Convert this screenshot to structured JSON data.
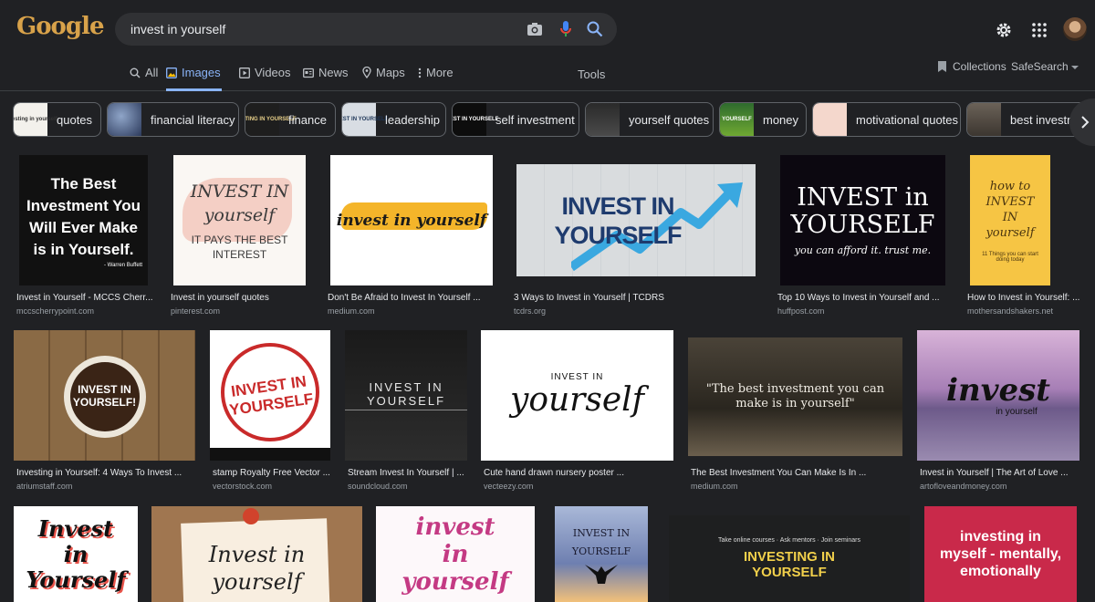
{
  "logo_text": "Google",
  "search": {
    "value": "invest in yourself"
  },
  "icons": {
    "camera": "camera-icon",
    "mic": "mic-icon",
    "search": "search-icon",
    "settings": "gear-icon",
    "apps": "apps-grid-icon"
  },
  "tabs": [
    {
      "label": "All"
    },
    {
      "label": "Images"
    },
    {
      "label": "Videos"
    },
    {
      "label": "News"
    },
    {
      "label": "Maps"
    },
    {
      "label": "More"
    }
  ],
  "tools_label": "Tools",
  "collections_label": "Collections",
  "safesearch_label": "SafeSearch",
  "chips": [
    {
      "label": "quotes",
      "thumb_text": "investing in yourself"
    },
    {
      "label": "financial literacy",
      "thumb_text": ""
    },
    {
      "label": "finance",
      "thumb_text": "INVESTING IN YOURSELF"
    },
    {
      "label": "leadership",
      "thumb_text": "INVEST IN YOURSELF"
    },
    {
      "label": "self investment",
      "thumb_text": "INVEST IN YOURSELF"
    },
    {
      "label": "yourself quotes",
      "thumb_text": ""
    },
    {
      "label": "money",
      "thumb_text": "YOURSELF"
    },
    {
      "label": "motivational quotes",
      "thumb_text": ""
    },
    {
      "label": "best investment",
      "thumb_text": ""
    }
  ],
  "results": [
    {
      "caption": "Invest in Yourself - MCCS Cherr...",
      "source": "mccscherrypoint.com",
      "img_text": "The Best Investment You Will Ever Make is in Yourself.",
      "img_sub": "- Warren Buffett"
    },
    {
      "caption": "Invest in yourself quotes",
      "source": "pinterest.com",
      "img_text": "INVEST IN yourself",
      "img_sub": "IT PAYS THE BEST INTEREST"
    },
    {
      "caption": "Don't Be Afraid to Invest In Yourself ...",
      "source": "medium.com",
      "img_text": "invest in yourself",
      "img_sub": ""
    },
    {
      "caption": "3 Ways to Invest in Yourself | TCDRS",
      "source": "tcdrs.org",
      "img_text": "INVEST IN YOURSELF",
      "img_sub": ""
    },
    {
      "caption": "Top 10 Ways to Invest in Yourself and ...",
      "source": "huffpost.com",
      "img_text": "INVEST in YOURSELF",
      "img_sub": "you can afford it. trust me."
    },
    {
      "caption": "How to Invest in Yourself: ...",
      "source": "mothersandshakers.net",
      "img_text": "how to INVEST IN yourself",
      "img_sub": "11 Things you can start doing today"
    },
    {
      "caption": "Investing in Yourself: 4 Ways To Invest ...",
      "source": "atriumstaff.com",
      "img_text": "INVEST IN YOURSELF!",
      "img_sub": ""
    },
    {
      "caption": "stamp Royalty Free Vector ...",
      "source": "vectorstock.com",
      "img_text": "INVEST IN YOURSELF",
      "img_sub": ""
    },
    {
      "caption": "Stream Invest In Yourself | ...",
      "source": "soundcloud.com",
      "img_text": "INVEST IN YOURSELF",
      "img_sub": ""
    },
    {
      "caption": "Cute hand drawn nursery poster ...",
      "source": "vecteezy.com",
      "img_text": "INVEST IN",
      "img_sub": "yourself"
    },
    {
      "caption": "The Best Investment You Can Make Is In ...",
      "source": "medium.com",
      "img_text": "\"The best investment you can make is in yourself\"",
      "img_sub": ""
    },
    {
      "caption": "Invest in Yourself | The Art of Love ...",
      "source": "artofloveandmoney.com",
      "img_text": "invest",
      "img_sub": "in yourself"
    },
    {
      "caption": "",
      "source": "",
      "img_text": "Invest in Yourself",
      "img_sub": ""
    },
    {
      "caption": "",
      "source": "",
      "img_text": "Invest in yourself",
      "img_sub": ""
    },
    {
      "caption": "",
      "source": "",
      "img_text": "invest in yourself",
      "img_sub": ""
    },
    {
      "caption": "",
      "source": "",
      "img_text": "INVEST IN YOURSELF",
      "img_sub": ""
    },
    {
      "caption": "",
      "source": "",
      "img_text": "INVESTING IN YOURSELF",
      "img_sub": "Take online courses · Ask mentors · Join seminars"
    },
    {
      "caption": "",
      "source": "",
      "img_text": "investing in myself - mentally, emotionally",
      "img_sub": ""
    }
  ]
}
